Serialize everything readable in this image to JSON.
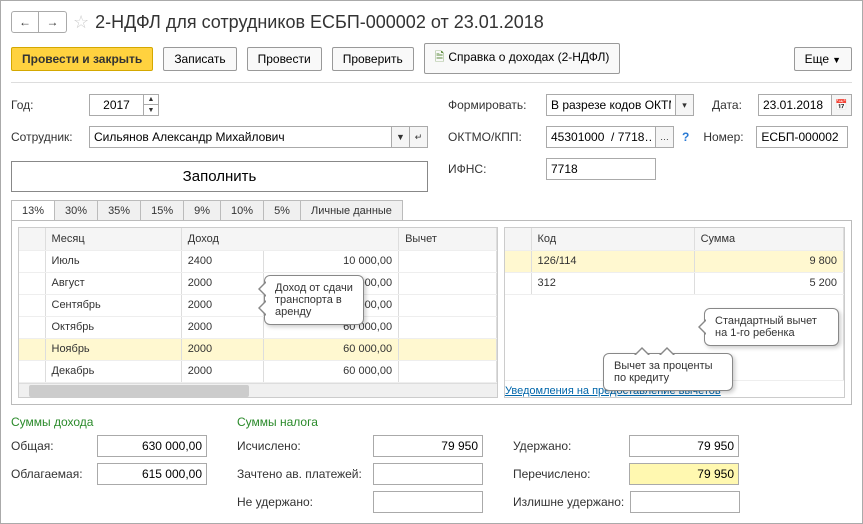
{
  "title": "2-НДФЛ для сотрудников ЕСБП-000002 от 23.01.2018",
  "toolbar": {
    "submit_close": "Провести и закрыть",
    "save": "Записать",
    "submit": "Провести",
    "check": "Проверить",
    "report": "Справка о доходах (2-НДФЛ)",
    "more": "Еще"
  },
  "form": {
    "year_label": "Год:",
    "year": "2017",
    "employee_label": "Сотрудник:",
    "employee": "Сильянов Александр Михайлович",
    "fill": "Заполнить",
    "format_label": "Формировать:",
    "format": "В разрезе кодов ОКТМО",
    "date_label": "Дата:",
    "date": "23.01.2018",
    "oktmo_label": "ОКТМО/КПП:",
    "oktmo": "45301000  / 7718…",
    "number_label": "Номер:",
    "number": "ЕСБП-000002",
    "ifns_label": "ИФНС:",
    "ifns": "7718"
  },
  "tabs": [
    "13%",
    "30%",
    "35%",
    "15%",
    "9%",
    "10%",
    "5%",
    "Личные данные"
  ],
  "income_table": {
    "headers": {
      "month": "Месяц",
      "income": "Доход",
      "deduct": "Вычет"
    },
    "rows": [
      {
        "month": "Июль",
        "code": "2400",
        "amount": "10 000,00",
        "sel": false
      },
      {
        "month": "Август",
        "code": "2000",
        "amount": "50 000,00",
        "sel": false
      },
      {
        "month": "Сентябрь",
        "code": "2000",
        "amount": "50 000,00",
        "sel": false
      },
      {
        "month": "Октябрь",
        "code": "2000",
        "amount": "60 000,00",
        "sel": false
      },
      {
        "month": "Ноябрь",
        "code": "2000",
        "amount": "60 000,00",
        "sel": true
      },
      {
        "month": "Декабрь",
        "code": "2000",
        "amount": "60 000,00",
        "sel": false
      }
    ]
  },
  "deduct_table": {
    "headers": {
      "code": "Код",
      "sum": "Сумма"
    },
    "rows": [
      {
        "code": "126/114",
        "sum": "9 800",
        "sel": true
      },
      {
        "code": "312",
        "sum": "5 200",
        "sel": false
      }
    ]
  },
  "callouts": {
    "rent": "Доход от сдачи транспорта в аренду",
    "credit": "Вычет за проценты по кредиту",
    "child": "Стандартный вычет на 1-го ребенка"
  },
  "totals": {
    "income_header": "Суммы дохода",
    "tax_header": "Суммы налога",
    "total_label": "Общая:",
    "total": "630 000,00",
    "taxable_label": "Облагаемая:",
    "taxable": "615 000,00",
    "calc_label": "Исчислено:",
    "calc": "79 950",
    "credited_label": "Зачтено ав. платежей:",
    "credited": "",
    "not_withheld_label": "Не удержано:",
    "not_withheld": "",
    "withheld_label": "Удержано:",
    "withheld": "79 950",
    "transferred_label": "Перечислено:",
    "transferred": "79 950",
    "over_withheld_label": "Излишне удержано:",
    "over_withheld": ""
  },
  "link": "Уведомления на предоставление вычетов"
}
